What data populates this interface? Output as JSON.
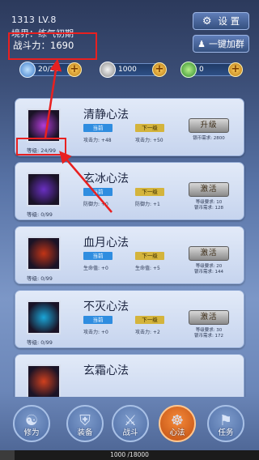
{
  "header": {
    "level_text": "1313 LV.8",
    "realm_text": "境界：练气初期",
    "power_label": "战斗力：",
    "power_value": "1690",
    "settings_label": "设 置",
    "join_group_label": "一键加群"
  },
  "resources": [
    {
      "icon": "energy-icon",
      "value": "20/20"
    },
    {
      "icon": "silver-coin-icon",
      "value": "1000"
    },
    {
      "icon": "jade-gem-icon",
      "value": "0"
    }
  ],
  "skills": [
    {
      "name": "清静心法",
      "level": "等级: 24/99",
      "current_tag": "当前",
      "next_tag": "下一级",
      "current_stat": "攻击力: +48",
      "next_stat": "攻击力: +50",
      "action": "升级",
      "requirement": "银币需求: 2800",
      "icon": "lotus-icon",
      "color": "#b23cd8"
    },
    {
      "name": "玄冰心法",
      "level": "等级:   0/99",
      "current_tag": "当前",
      "next_tag": "下一级",
      "current_stat": "防御力: +0",
      "next_stat": "防御力: +1",
      "action": "激活",
      "requirement": "等级要求: 10\n银币需求: 128",
      "icon": "ice-meditation-icon",
      "color": "#6a2fc2"
    },
    {
      "name": "血月心法",
      "level": "等级:   0/99",
      "current_tag": "当前",
      "next_tag": "下一级",
      "current_stat": "生命值: +0",
      "next_stat": "生命值: +5",
      "action": "激活",
      "requirement": "等级要求: 20\n银币需求: 144",
      "icon": "blood-slash-icon",
      "color": "#c23416"
    },
    {
      "name": "不灭心法",
      "level": "等级:   0/99",
      "current_tag": "当前",
      "next_tag": "下一级",
      "current_stat": "攻击力: +0",
      "next_stat": "攻击力: +2",
      "action": "激活",
      "requirement": "等级要求: 30\n银币需求: 172",
      "icon": "wind-swirl-icon",
      "color": "#1aa6d8"
    },
    {
      "name": "玄霜心法",
      "level": "",
      "current_tag": "",
      "next_tag": "",
      "current_stat": "",
      "next_stat": "",
      "action": "",
      "requirement": "",
      "icon": "frost-fire-icon",
      "color": "#d0401e"
    }
  ],
  "tabs": [
    {
      "label": "修为",
      "icon": "meditate-icon",
      "glyph": "☯"
    },
    {
      "label": "装备",
      "icon": "armor-icon",
      "glyph": "⛨"
    },
    {
      "label": "战斗",
      "icon": "crossed-swords-icon",
      "glyph": "⚔"
    },
    {
      "label": "心法",
      "icon": "flame-mind-icon",
      "glyph": "☸"
    },
    {
      "label": "任务",
      "icon": "flag-icon",
      "glyph": "⚑"
    }
  ],
  "xp": {
    "text": "1000 /18000",
    "fraction": 0.0556
  },
  "colors": {
    "highlight": "#e82020",
    "active_tab": "#f58a3a"
  }
}
